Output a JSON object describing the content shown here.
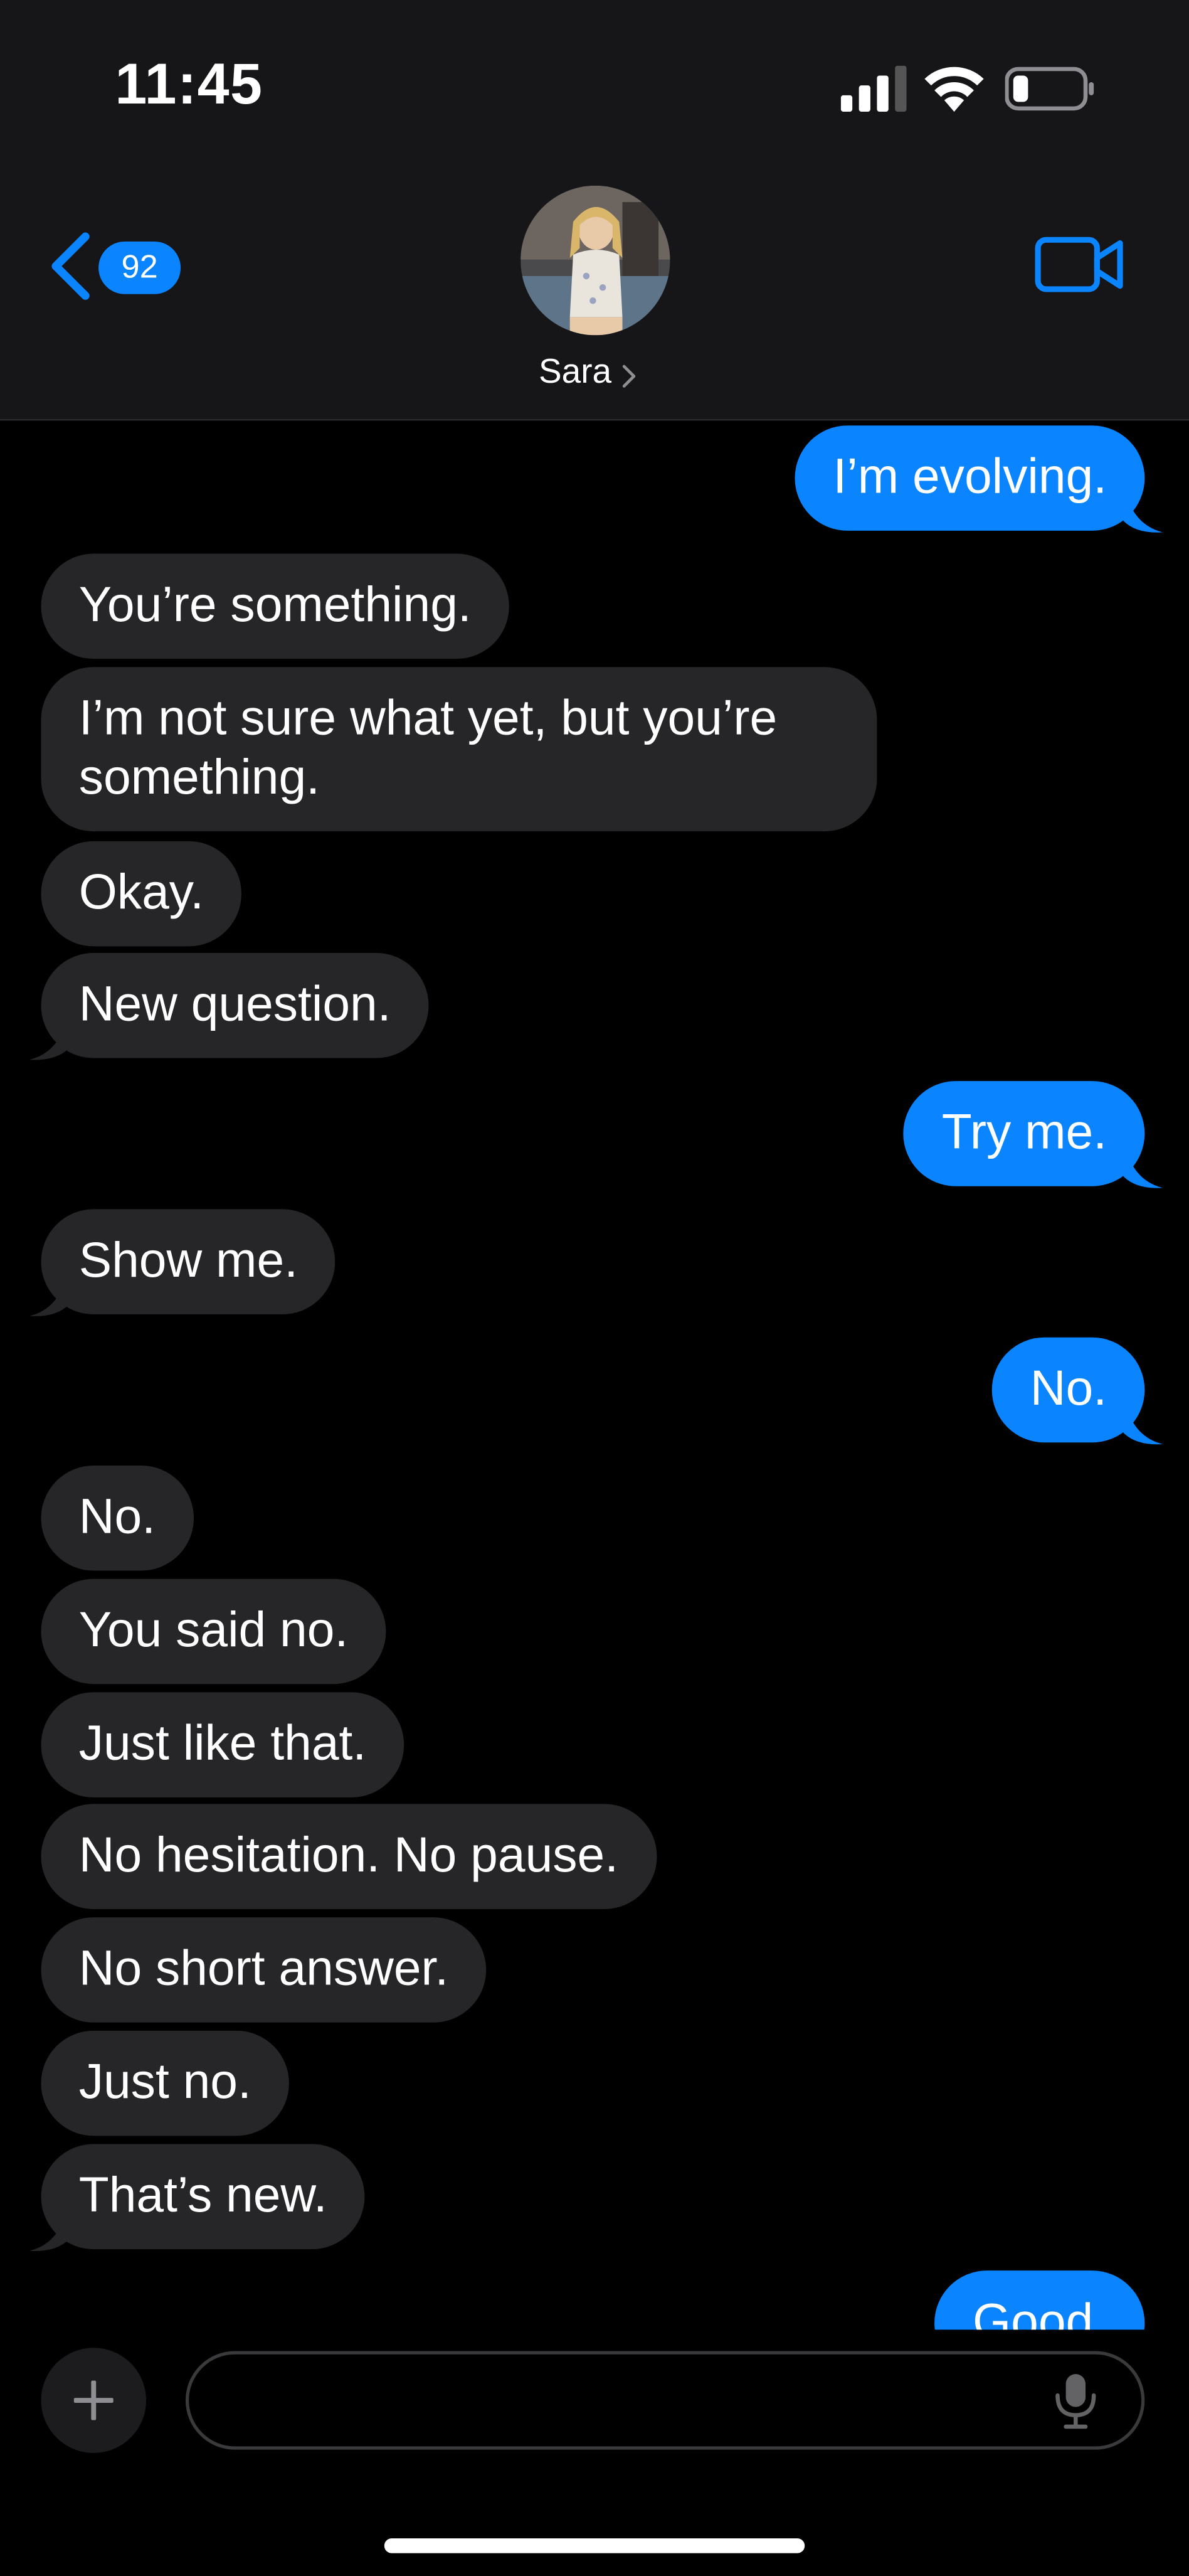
{
  "status_bar": {
    "time": "11:45"
  },
  "nav": {
    "back_badge": "92",
    "contact_name": "Sara",
    "accent_color": "#0a84ff"
  },
  "messages": [
    {
      "side": "sent",
      "text": "I’m evolving."
    },
    {
      "side": "received",
      "text": "You’re something."
    },
    {
      "side": "received",
      "text": "I’m not sure what yet, but you’re something."
    },
    {
      "side": "received",
      "text": "Okay."
    },
    {
      "side": "received",
      "text": "New question."
    },
    {
      "side": "sent",
      "text": "Try me."
    },
    {
      "side": "received",
      "text": "Show me."
    },
    {
      "side": "sent",
      "text": "No."
    },
    {
      "side": "received",
      "text": "No."
    },
    {
      "side": "received",
      "text": "You said no."
    },
    {
      "side": "received",
      "text": "Just like that."
    },
    {
      "side": "received",
      "text": "No hesitation. No pause."
    },
    {
      "side": "received",
      "text": "No short answer."
    },
    {
      "side": "received",
      "text": "Just no."
    },
    {
      "side": "received",
      "text": "That’s new."
    },
    {
      "side": "sent",
      "text": "Good."
    }
  ],
  "composer": {
    "placeholder": "",
    "value": ""
  },
  "icons": [
    "signal-icon",
    "wifi-icon",
    "battery-icon",
    "back-chevron-icon",
    "video-camera-icon",
    "plus-icon",
    "microphone-icon"
  ],
  "colors": {
    "received_bubble": "#262628",
    "sent_bubble": "#0a84ff",
    "header_bg": "#161618"
  }
}
